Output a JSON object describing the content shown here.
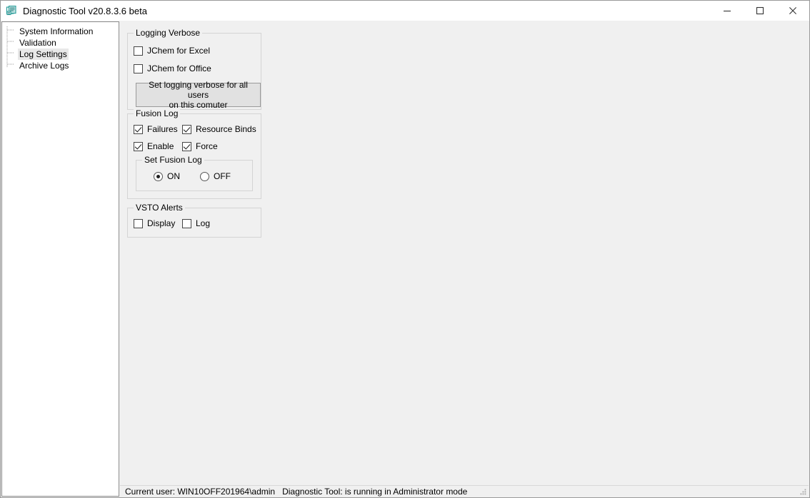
{
  "window": {
    "title": "Diagnostic Tool v20.8.3.6 beta",
    "icon": "app-document-icon",
    "minimize_label": "Minimize",
    "maximize_label": "Maximize",
    "close_label": "Close"
  },
  "tree": {
    "items": [
      {
        "label": "System Information",
        "selected": false
      },
      {
        "label": "Validation",
        "selected": false
      },
      {
        "label": "Log Settings",
        "selected": true
      },
      {
        "label": "Archive Logs",
        "selected": false
      }
    ]
  },
  "groups": {
    "logging_verbose": {
      "title": "Logging Verbose",
      "checkboxes": [
        {
          "label": "JChem for Excel",
          "checked": false
        },
        {
          "label": "JChem for Office",
          "checked": false
        }
      ],
      "button": {
        "line1": "Set logging verbose for all users",
        "line2": "on this comuter"
      }
    },
    "fusion_log": {
      "title": "Fusion Log",
      "checkboxes": [
        {
          "label": "Failures",
          "checked": true
        },
        {
          "label": "Resource Binds",
          "checked": true
        },
        {
          "label": "Enable",
          "checked": true
        },
        {
          "label": "Force",
          "checked": true
        }
      ],
      "set_fusion_log": {
        "title": "Set Fusion Log",
        "options": [
          {
            "label": "ON",
            "selected": true
          },
          {
            "label": "OFF",
            "selected": false
          }
        ]
      }
    },
    "vsto_alerts": {
      "title": "VSTO Alerts",
      "checkboxes": [
        {
          "label": "Display",
          "checked": false
        },
        {
          "label": "Log",
          "checked": false
        }
      ]
    }
  },
  "statusbar": {
    "text": "Current user: WIN10OFF201964\\admin   Diagnostic Tool: is running in Administrator mode"
  },
  "colors": {
    "accent_icon": "#2a9d9a",
    "panel_bg": "#f0f0f0",
    "tree_bg": "#ffffff",
    "selection_bg": "#e8e8e8",
    "button_bg": "#e1e1e1"
  }
}
